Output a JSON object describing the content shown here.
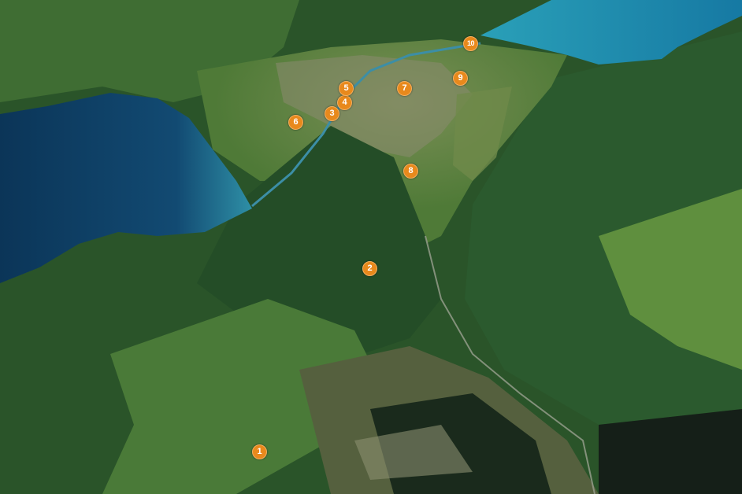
{
  "colors": {
    "marker_fill": "#e8891c",
    "marker_text": "#ffffff",
    "lake_deep": "#0d3d63",
    "lake_turquoise": "#1f8fb0",
    "forest": "#1f4a24",
    "meadow": "#5f8f3e"
  },
  "markers": [
    {
      "label": "1"
    },
    {
      "label": "2"
    },
    {
      "label": "3"
    },
    {
      "label": "4"
    },
    {
      "label": "5"
    },
    {
      "label": "6"
    },
    {
      "label": "7"
    },
    {
      "label": "8"
    },
    {
      "label": "9"
    },
    {
      "label": "10"
    }
  ]
}
